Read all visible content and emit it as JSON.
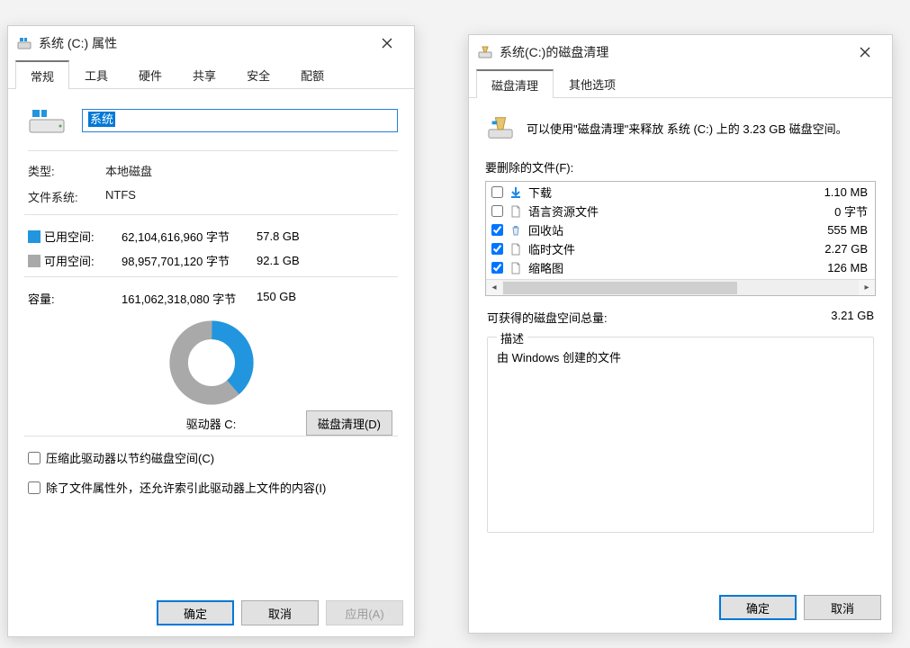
{
  "left": {
    "title": "系统 (C:) 属性",
    "tabs": [
      "常规",
      "工具",
      "硬件",
      "共享",
      "安全",
      "配额"
    ],
    "active_tab": 0,
    "drive_name": "系统",
    "type_label": "类型:",
    "type_value": "本地磁盘",
    "fs_label": "文件系统:",
    "fs_value": "NTFS",
    "used_label": "已用空间:",
    "used_bytes": "62,104,616,960 字节",
    "used_gb": "57.8 GB",
    "free_label": "可用空间:",
    "free_bytes": "98,957,701,120 字节",
    "free_gb": "92.1 GB",
    "capacity_label": "容量:",
    "capacity_bytes": "161,062,318,080 字节",
    "capacity_gb": "150 GB",
    "drive_label": "驱动器 C:",
    "cleanup_btn": "磁盘清理(D)",
    "compress_cb": "压缩此驱动器以节约磁盘空间(C)",
    "index_cb": "除了文件属性外，还允许索引此驱动器上文件的内容(I)",
    "ok_btn": "确定",
    "cancel_btn": "取消",
    "apply_btn": "应用(A)"
  },
  "right": {
    "title": "系统(C:)的磁盘清理",
    "tabs": [
      "磁盘清理",
      "其他选项"
    ],
    "active_tab": 0,
    "intro": "可以使用\"磁盘清理\"来释放 系统 (C:) 上的 3.23 GB 磁盘空间。",
    "files_label": "要删除的文件(F):",
    "files": [
      {
        "checked": false,
        "icon": "download",
        "name": "下载",
        "size": "1.10 MB"
      },
      {
        "checked": false,
        "icon": "doc",
        "name": "语言资源文件",
        "size": "0 字节"
      },
      {
        "checked": true,
        "icon": "recycle",
        "name": "回收站",
        "size": "555 MB"
      },
      {
        "checked": true,
        "icon": "doc",
        "name": "临时文件",
        "size": "2.27 GB"
      },
      {
        "checked": true,
        "icon": "doc",
        "name": "缩略图",
        "size": "126 MB"
      }
    ],
    "gain_label": "可获得的磁盘空间总量:",
    "gain_value": "3.21 GB",
    "desc_legend": "描述",
    "desc_text": "由 Windows 创建的文件",
    "ok_btn": "确定",
    "cancel_btn": "取消"
  },
  "chart_data": {
    "type": "pie",
    "title": "驱动器 C:",
    "series": [
      {
        "name": "已用空间",
        "value": 57.8,
        "color": "#2196de"
      },
      {
        "name": "可用空间",
        "value": 92.1,
        "color": "#a9a9a9"
      }
    ],
    "unit": "GB",
    "total": 150
  }
}
